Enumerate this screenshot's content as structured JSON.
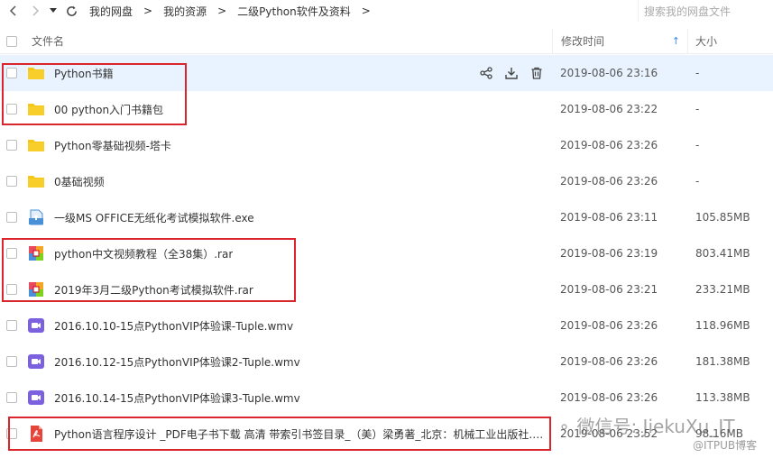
{
  "toolbar": {
    "breadcrumbs": [
      "我的网盘",
      "我的资源",
      "二级Python软件及资料"
    ],
    "search_placeholder": "搜索我的网盘文件"
  },
  "header": {
    "name": "文件名",
    "time": "修改时间",
    "size": "大小"
  },
  "files": [
    {
      "name": "Python书籍",
      "time": "2019-08-06 23:16",
      "size": "-",
      "type": "folder"
    },
    {
      "name": "00 python入门书籍包",
      "time": "2019-08-06 23:22",
      "size": "-",
      "type": "folder"
    },
    {
      "name": "Python零基础视频-塔卡",
      "time": "2019-08-06 23:26",
      "size": "-",
      "type": "folder"
    },
    {
      "name": "0基础视频",
      "time": "2019-08-06 23:26",
      "size": "-",
      "type": "folder"
    },
    {
      "name": "一级MS OFFICE无纸化考试模拟软件.exe",
      "time": "2019-08-06 23:11",
      "size": "105.85MB",
      "type": "exe"
    },
    {
      "name": "python中文视频教程（全38集）.rar",
      "time": "2019-08-06 23:19",
      "size": "803.41MB",
      "type": "rar"
    },
    {
      "name": "2019年3月二级Python考试模拟软件.rar",
      "time": "2019-08-06 23:21",
      "size": "233.21MB",
      "type": "rar"
    },
    {
      "name": "2016.10.10-15点PythonVIP体验课-Tuple.wmv",
      "time": "2019-08-06 23:26",
      "size": "118.96MB",
      "type": "video"
    },
    {
      "name": "2016.10.12-15点PythonVIP体验课2-Tuple.wmv",
      "time": "2019-08-06 23:26",
      "size": "181.38MB",
      "type": "video"
    },
    {
      "name": "2016.10.14-15点PythonVIP体验课3-Tuple.wmv",
      "time": "2019-08-06 23:26",
      "size": "113.38MB",
      "type": "video"
    },
    {
      "name": "Python语言程序设计 _PDF电子书下载 高清 带索引书签目录_（美）梁勇著_北京：机械工业出版社.p...",
      "time": "2019-08-06 23:52",
      "size": "98.16MB",
      "type": "pdf"
    }
  ],
  "watermark": {
    "line1": "微信号: JiekuXu_IT",
    "line2": "@ITPUB博客"
  },
  "colors": {
    "folder": "#f5c518",
    "highlight": "#d9252b",
    "hover_row": "#e8f3ff",
    "sort_arrow": "#3b8cf0"
  }
}
